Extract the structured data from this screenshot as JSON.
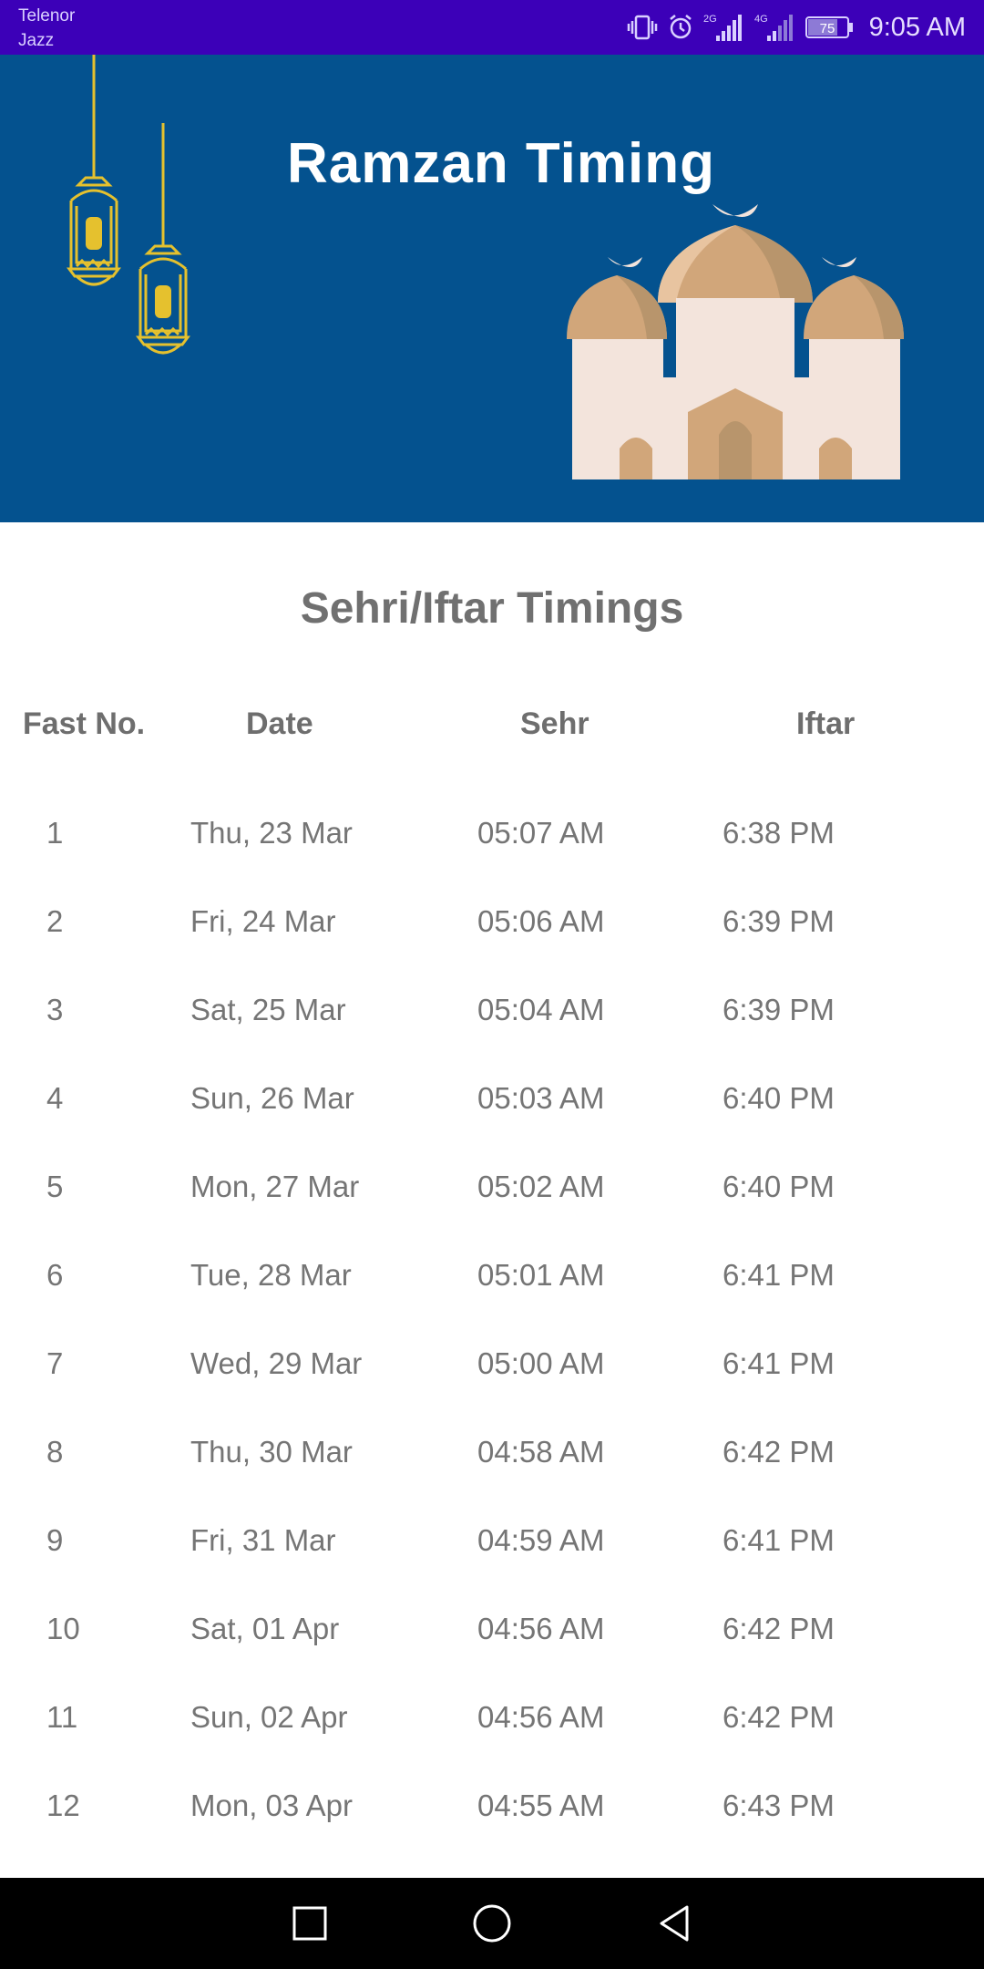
{
  "status_bar": {
    "carrier_line1": "Telenor",
    "carrier_line2": "Jazz",
    "network_1": "2G",
    "network_2": "4G",
    "battery": "75",
    "time": "9:05 AM"
  },
  "header": {
    "title": "Ramzan Timing"
  },
  "main": {
    "section_title": "Sehri/Iftar Timings",
    "columns": [
      "Fast No.",
      "Date",
      "Sehr",
      "Iftar"
    ],
    "rows": [
      {
        "no": "1",
        "date": "Thu, 23 Mar",
        "sehr": "05:07 AM",
        "iftar": "6:38 PM"
      },
      {
        "no": "2",
        "date": "Fri, 24 Mar",
        "sehr": "05:06 AM",
        "iftar": "6:39 PM"
      },
      {
        "no": "3",
        "date": "Sat, 25 Mar",
        "sehr": "05:04 AM",
        "iftar": "6:39 PM"
      },
      {
        "no": "4",
        "date": "Sun, 26 Mar",
        "sehr": "05:03 AM",
        "iftar": "6:40 PM"
      },
      {
        "no": "5",
        "date": "Mon, 27 Mar",
        "sehr": "05:02 AM",
        "iftar": "6:40 PM"
      },
      {
        "no": "6",
        "date": "Tue, 28 Mar",
        "sehr": "05:01 AM",
        "iftar": "6:41 PM"
      },
      {
        "no": "7",
        "date": "Wed, 29 Mar",
        "sehr": "05:00 AM",
        "iftar": "6:41 PM"
      },
      {
        "no": "8",
        "date": "Thu, 30 Mar",
        "sehr": "04:58 AM",
        "iftar": "6:42 PM"
      },
      {
        "no": "9",
        "date": "Fri, 31 Mar",
        "sehr": "04:59 AM",
        "iftar": "6:41 PM"
      },
      {
        "no": "10",
        "date": "Sat, 01 Apr",
        "sehr": "04:56 AM",
        "iftar": "6:42 PM"
      },
      {
        "no": "11",
        "date": "Sun, 02 Apr",
        "sehr": "04:56 AM",
        "iftar": "6:42 PM"
      },
      {
        "no": "12",
        "date": "Mon, 03 Apr",
        "sehr": "04:55 AM",
        "iftar": "6:43 PM"
      }
    ]
  },
  "nav_bar": {
    "buttons": [
      "recents-icon",
      "home-icon",
      "back-icon"
    ]
  },
  "colors": {
    "status_bar": "#3c00b8",
    "banner": "#04528f",
    "lantern": "#e5c12e",
    "dome": "#d1a67a",
    "mosque_wall": "#f3e4dc",
    "text_gray": "#707070"
  }
}
